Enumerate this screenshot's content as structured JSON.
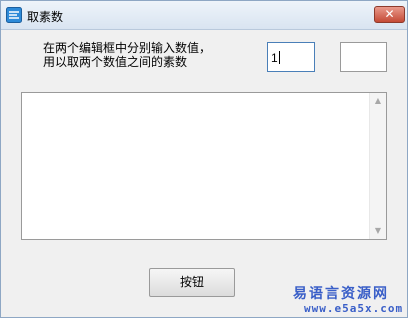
{
  "window": {
    "title": "取素数",
    "close_glyph": "✕"
  },
  "description": {
    "line1": "在两个编辑框中分别输入数值，",
    "line2": "用以取两个数值之间的素数"
  },
  "inputs": {
    "first_value": "1",
    "second_value": ""
  },
  "output": {
    "text": "",
    "scroll_up_glyph": "▲",
    "scroll_down_glyph": "▼"
  },
  "button": {
    "label": "按钮"
  },
  "watermark": {
    "site_name": "易语言资源网",
    "url": "www.e5a5x.com"
  },
  "colors": {
    "accent_blue": "#4a7fb8",
    "watermark": "#3a5fc8",
    "close_red": "#c44a36"
  }
}
